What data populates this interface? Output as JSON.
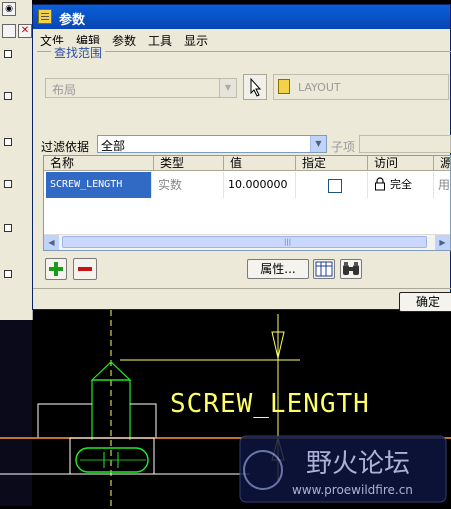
{
  "dialog": {
    "title": "参数",
    "menu": [
      "文件",
      "编辑",
      "参数",
      "工具",
      "显示"
    ],
    "search_scope_label": "查找范围",
    "scope_value": "布局",
    "layout_value": "LAYOUT",
    "filter_label": "过滤依据",
    "filter_value": "全部",
    "sub_item_label": "子项",
    "table": {
      "headers": [
        "名称",
        "类型",
        "值",
        "指定",
        "访问",
        "源"
      ],
      "rows": [
        {
          "name": "SCREW_LENGTH",
          "type": "实数",
          "value": "10.000000",
          "designated": false,
          "access": "完全",
          "source": "用"
        }
      ]
    },
    "properties_label": "属性...",
    "ok_label": "确定"
  },
  "cad": {
    "dimension_label": "SCREW_LENGTH",
    "watermark_title": "野火论坛",
    "watermark_url": "www.proewildfire.cn"
  },
  "colors": {
    "titlebar": "#0a5fd8",
    "selection": "#316ac5",
    "cad_yellow": "#ffff66",
    "cad_green": "#22ee22",
    "cad_orange": "#ff9933"
  }
}
